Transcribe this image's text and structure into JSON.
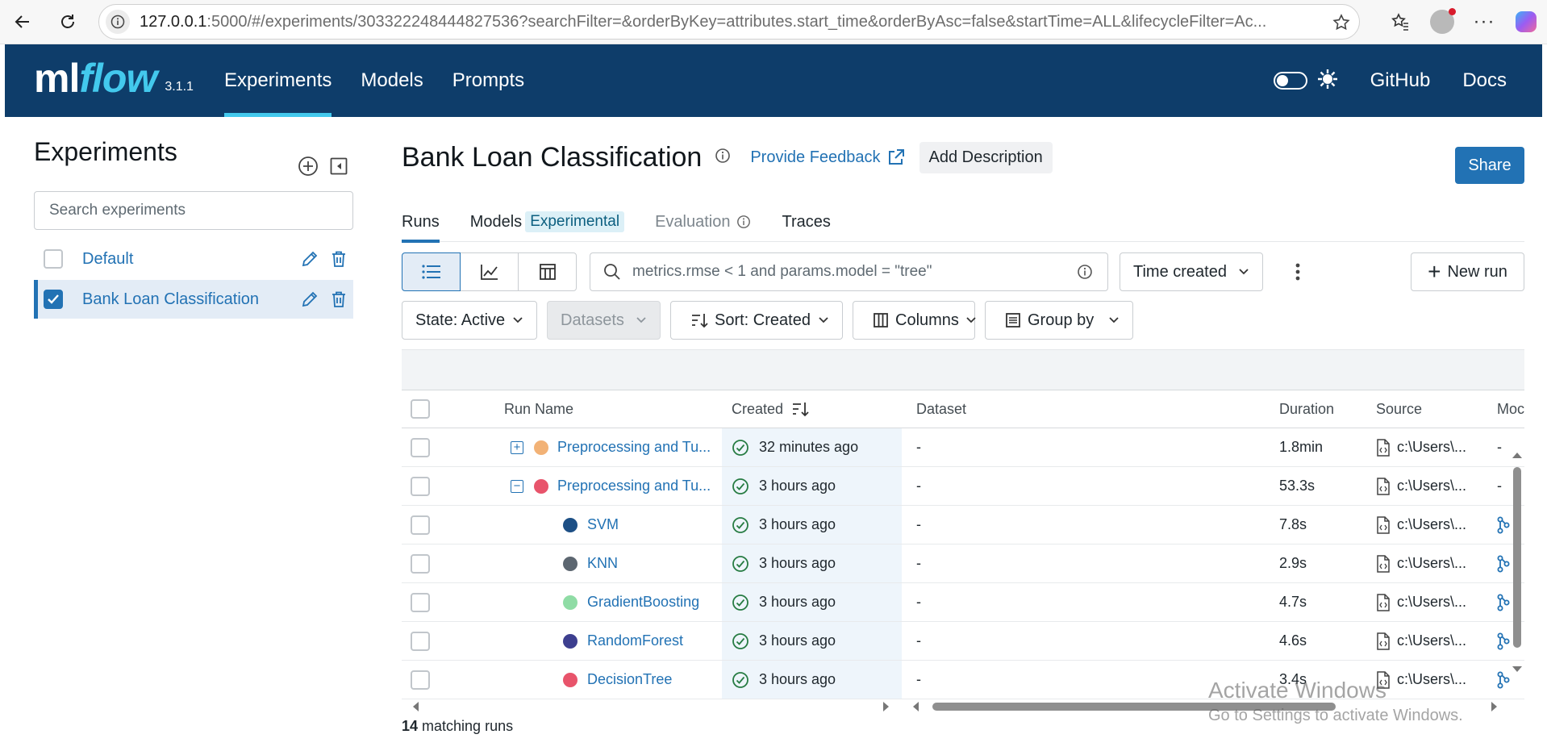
{
  "browser": {
    "url_host": "127.0.0.1",
    "url_rest": ":5000/#/experiments/303322248444827536?searchFilter=&orderByKey=attributes.start_time&orderByAsc=false&startTime=ALL&lifecycleFilter=Ac..."
  },
  "app": {
    "logo_ml": "ml",
    "logo_flow": "flow",
    "version": "3.1.1",
    "nav": [
      "Experiments",
      "Models",
      "Prompts"
    ],
    "links": [
      "GitHub",
      "Docs"
    ]
  },
  "sidebar": {
    "title": "Experiments",
    "search_placeholder": "Search experiments",
    "experiments": [
      {
        "name": "Default",
        "checked": false
      },
      {
        "name": "Bank Loan Classification",
        "checked": true
      }
    ]
  },
  "page": {
    "title": "Bank Loan Classification",
    "feedback": "Provide Feedback",
    "add_description": "Add Description",
    "share": "Share"
  },
  "tabs": {
    "runs": "Runs",
    "models": "Models",
    "models_badge": "Experimental",
    "evaluation": "Evaluation",
    "traces": "Traces"
  },
  "toolbar": {
    "search_placeholder": "metrics.rmse < 1 and params.model = \"tree\"",
    "time_created": "Time created",
    "new_run": "New run",
    "state": "State: Active",
    "datasets": "Datasets",
    "sort": "Sort: Created",
    "columns": "Columns",
    "group_by": "Group by"
  },
  "table": {
    "headers": [
      "Run Name",
      "Created",
      "Dataset",
      "Duration",
      "Source",
      "Moc"
    ],
    "rows": [
      {
        "name": "Preprocessing and Tu...",
        "created": "32 minutes ago",
        "dataset": "-",
        "duration": "1.8min",
        "source": "c:\\Users\\...",
        "model": "-",
        "color": "#f2b276",
        "expander": "+",
        "child": false
      },
      {
        "name": "Preprocessing and Tu...",
        "created": "3 hours ago",
        "dataset": "-",
        "duration": "53.3s",
        "source": "c:\\Users\\...",
        "model": "-",
        "color": "#e8546b",
        "expander": "−",
        "child": false
      },
      {
        "name": "SVM",
        "created": "3 hours ago",
        "dataset": "-",
        "duration": "7.8s",
        "source": "c:\\Users\\...",
        "model": "",
        "color": "#1d4f85",
        "expander": "",
        "child": true
      },
      {
        "name": "KNN",
        "created": "3 hours ago",
        "dataset": "-",
        "duration": "2.9s",
        "source": "c:\\Users\\...",
        "model": "",
        "color": "#5c6670",
        "expander": "",
        "child": true
      },
      {
        "name": "GradientBoosting",
        "created": "3 hours ago",
        "dataset": "-",
        "duration": "4.7s",
        "source": "c:\\Users\\...",
        "model": "",
        "color": "#8fdca5",
        "expander": "",
        "child": true
      },
      {
        "name": "RandomForest",
        "created": "3 hours ago",
        "dataset": "-",
        "duration": "4.6s",
        "source": "c:\\Users\\...",
        "model": "",
        "color": "#3d3f8f",
        "expander": "",
        "child": true
      },
      {
        "name": "DecisionTree",
        "created": "3 hours ago",
        "dataset": "-",
        "duration": "3.4s",
        "source": "c:\\Users\\...",
        "model": "",
        "color": "#e8546b",
        "expander": "",
        "child": true
      }
    ]
  },
  "footer": {
    "count": "14",
    "label": " matching runs"
  },
  "watermark": {
    "line1": "Activate Windows",
    "line2": "Go to Settings to activate Windows."
  },
  "colors": {
    "header_bg": "#0e3d6a",
    "accent": "#2272b4",
    "logo_flow": "#43c9ed",
    "success": "#277c43"
  }
}
